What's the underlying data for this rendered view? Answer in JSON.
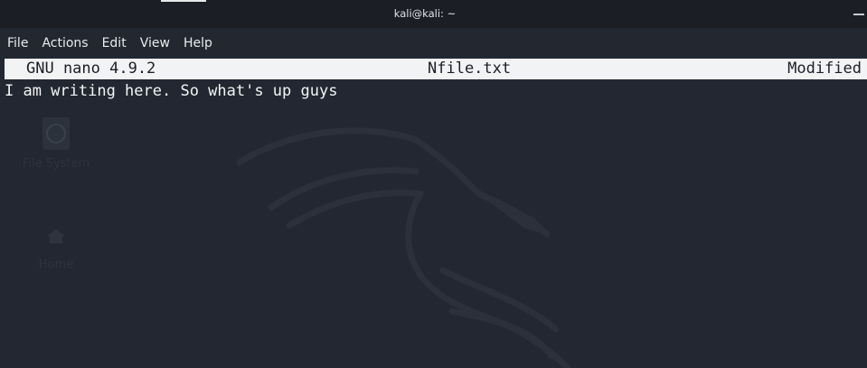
{
  "window": {
    "title": "kali@kali: ~"
  },
  "menu": {
    "items": [
      "File",
      "Actions",
      "Edit",
      "View",
      "Help"
    ]
  },
  "desktop": {
    "icons": [
      {
        "label": "File System",
        "icon": "drive-icon"
      },
      {
        "label": "Home",
        "icon": "home-icon"
      }
    ]
  },
  "nano": {
    "version": "GNU nano 4.9.2",
    "filename": "Nfile.txt",
    "status": "Modified",
    "lines": [
      "I am writing here. So what's up guys"
    ]
  },
  "colors": {
    "background": "#222731",
    "titlebar": "#1b1e24",
    "header_bg": "#f2f3f5",
    "text": "#f3f4f6"
  }
}
